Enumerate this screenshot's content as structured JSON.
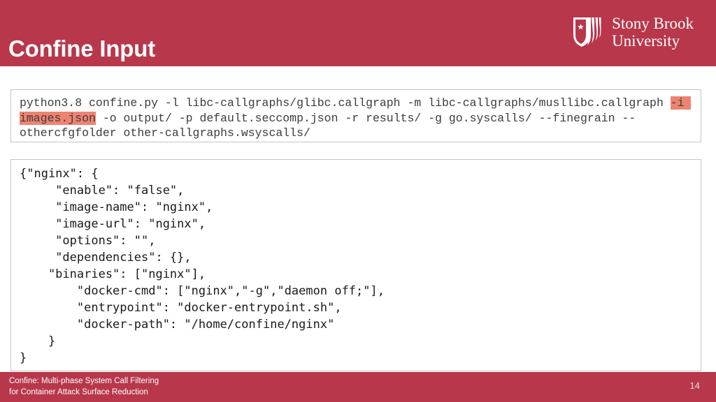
{
  "theme": {
    "brand_red": "#b8374b",
    "highlight_salmon": "#ee8372",
    "box_border": "#c6c6c6",
    "code_text": "#3c3c3c"
  },
  "header": {
    "title": "Confine Input",
    "logo": {
      "icon": "stony-brook-shield-icon",
      "line1": "Stony Brook",
      "line2": "University"
    }
  },
  "command_block": {
    "segment_1": "python3.8 confine.py -l libc-callgraphs/glibc.callgraph -m libc-callgraphs/musllibc.callgraph ",
    "highlighted": "-i images.json",
    "segment_2": " -o output/ -p default.seccomp.json -r results/ -g go.syscalls/ --finegrain --othercfgfolder other-callgraphs.wsyscalls/",
    "full_command": "python3.8 confine.py -l libc-callgraphs/glibc.callgraph -m libc-callgraphs/musllibc.callgraph -i images.json -o output/ -p default.seccomp.json -r results/ -g go.syscalls/ --finegrain --othercfgfolder other-callgraphs.wsyscalls/"
  },
  "json_block": {
    "lines": [
      "{\"nginx\": {",
      "     \"enable\": \"false\",",
      "     \"image-name\": \"nginx\",",
      "     \"image-url\": \"nginx\",",
      "     \"options\": \"\",",
      "     \"dependencies\": {},",
      "    \"binaries\": [\"nginx\"],",
      "        \"docker-cmd\": [\"nginx\",\"-g\",\"daemon off;\"],",
      "        \"entrypoint\": \"docker-entrypoint.sh\",",
      "        \"docker-path\": \"/home/confine/nginx\"",
      "    }",
      "}"
    ],
    "text": "{\"nginx\": {\n     \"enable\": \"false\",\n     \"image-name\": \"nginx\",\n     \"image-url\": \"nginx\",\n     \"options\": \"\",\n     \"dependencies\": {},\n    \"binaries\": [\"nginx\"],\n        \"docker-cmd\": [\"nginx\",\"-g\",\"daemon off;\"],\n        \"entrypoint\": \"docker-entrypoint.sh\",\n        \"docker-path\": \"/home/confine/nginx\"\n    }\n}"
  },
  "footer": {
    "line1": "Confine: Multi-phase System Call Filtering",
    "line2": "for Container Attack Surface Reduction",
    "page_number": "14"
  }
}
